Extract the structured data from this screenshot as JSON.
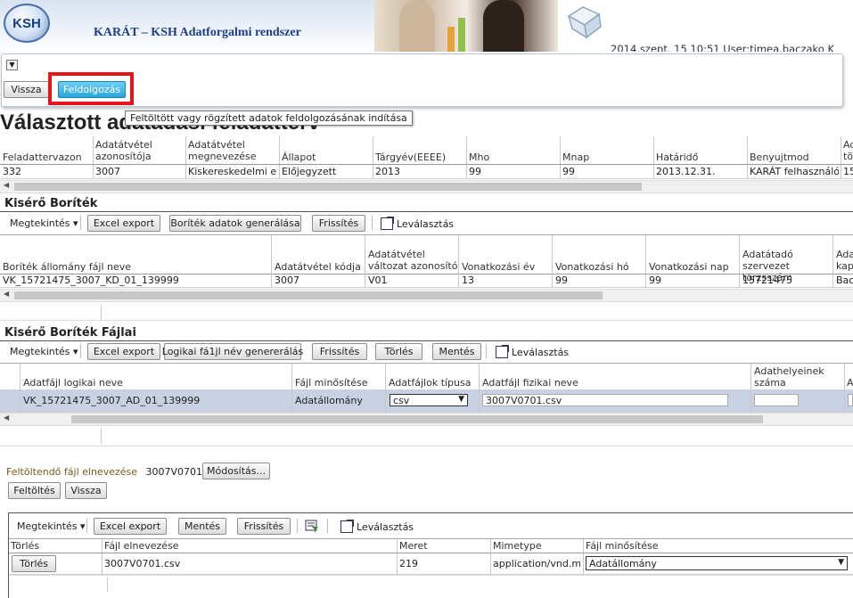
{
  "header": {
    "logo": "KSH",
    "app_title": "KARÁT – KSH Adatforgalmi rendszer",
    "userinfo": "2014.szept. 15 10:51    User:timea.baczako    K"
  },
  "toolbar": {
    "expander_icon": "chevron-down-icon",
    "back": "Vissza",
    "process": "Feldolgozás",
    "tooltip": "Feltöltött vagy rögzített adatok feldolgozásának indítása"
  },
  "page_title": "Választott adatadási feladatterv",
  "plan_table": {
    "headers": [
      "Feladattervazon",
      "Adatátvétel azonosítója",
      "Adatátvétel megnevezése",
      "Állapot",
      "Tárgyév(EEEE)",
      "Mho",
      "Mnap",
      "Határidő",
      "Benyujtmod",
      "Ad tö"
    ],
    "row": [
      "332",
      "3007",
      "Kiskereskedelmi e...",
      "Előjegyzett",
      "2013",
      "99",
      "99",
      "2013.12.31.",
      "KARÁT felhasználó...",
      "15"
    ]
  },
  "envelope": {
    "title": "Kisérő Boríték",
    "view_menu": "Megtekintés",
    "excel": "Excel export",
    "generate": "Boríték adatok generálása",
    "refresh": "Frissítés",
    "detach": "Leválasztás",
    "headers": [
      "Boríték állomány fájl neve",
      "Adatátvétel kódja",
      "Adatátvétel változat azonosító",
      "Vonatkozási év",
      "Vonatkozási hó",
      "Vonatkozási nap",
      "Adatátadó szervezet törzsszám",
      "Ada kap"
    ],
    "row": [
      "VK_15721475_3007_KD_01_139999",
      "3007",
      "V01",
      "13",
      "99",
      "99",
      "15721475",
      "Bac"
    ]
  },
  "files": {
    "title": "Kisérő Boríték Fájlai",
    "view_menu": "Megtekintés",
    "excel": "Excel export",
    "logical_gen": "Logikai fá1jl név genererálás",
    "refresh": "Frissítés",
    "delete": "Törlés",
    "save": "Mentés",
    "detach": "Leválasztás",
    "headers": [
      "Adatfájl logikai neve",
      "Fájl minősítése",
      "Adatfájlok típusa",
      "Adatfájl fizikai neve",
      "Adathelyeinek száma",
      "A"
    ],
    "row": {
      "logical": "VK_15721475_3007_AD_01_139999",
      "qual": "Adatállomány",
      "type": "csv",
      "physical": "3007V0701.csv",
      "count": ""
    }
  },
  "upload": {
    "label": "Feltöltendő fájl elnevezése",
    "value": "3007V0701.csv",
    "modify": "Módosítás...",
    "upload_btn": "Feltöltés",
    "back": "Vissza"
  },
  "bottom": {
    "view_menu": "Megtekintés",
    "excel": "Excel export",
    "save": "Mentés",
    "refresh": "Frissítés",
    "detach": "Leválasztás",
    "headers": [
      "Törlés",
      "Fájl elnevezése",
      "Meret",
      "Mimetype",
      "Fájl minősítése"
    ],
    "row": {
      "delete_btn": "Törlés",
      "name": "3007V0701.csv",
      "size": "219",
      "mime": "application/vnd.m...",
      "qual": "Adatállomány"
    }
  }
}
